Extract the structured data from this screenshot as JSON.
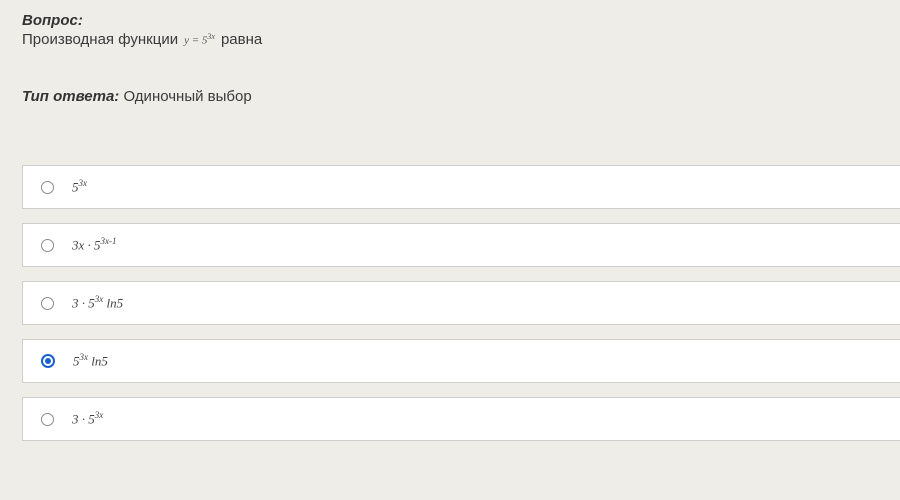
{
  "question": {
    "label": "Вопрос:",
    "text_before": "Производная функции",
    "formula_html": "y = 5<sup>3x</sup>",
    "text_after": "равна"
  },
  "answer_type": {
    "label": "Тип ответа:",
    "value": "Одиночный выбор"
  },
  "options": [
    {
      "html": "5<sup>3x</sup>",
      "selected": false
    },
    {
      "html": "3x · 5<sup>3x-1</sup>",
      "selected": false
    },
    {
      "html": "3 · 5<sup>3x</sup> ln5",
      "selected": false
    },
    {
      "html": "5<sup>3x</sup> ln5",
      "selected": true
    },
    {
      "html": "3 · 5<sup>3x</sup>",
      "selected": false
    }
  ]
}
